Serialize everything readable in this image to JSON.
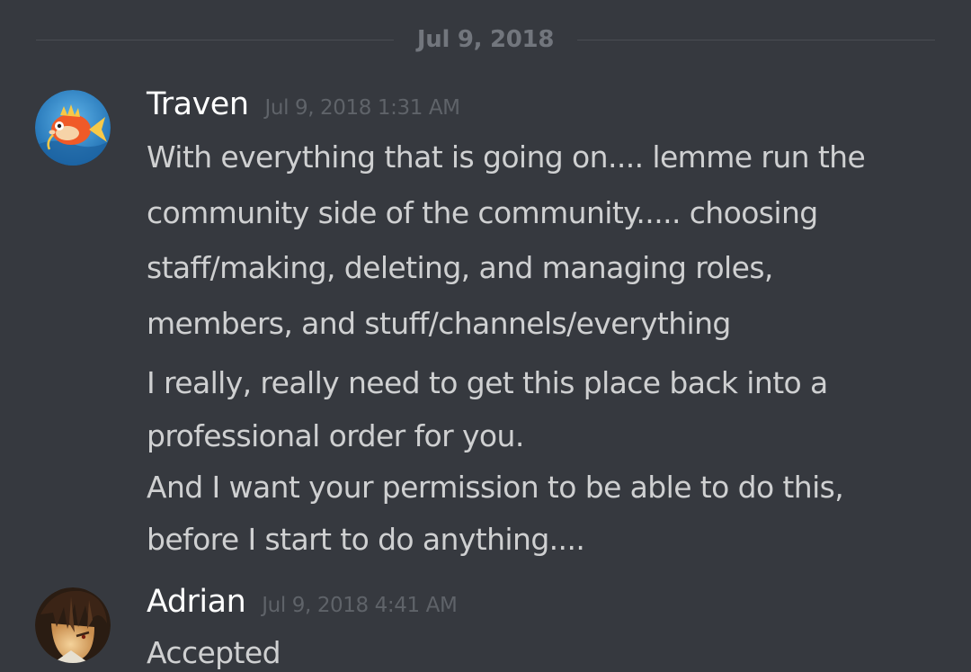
{
  "divider": {
    "date": "Jul 9, 2018"
  },
  "messages": [
    {
      "author": "Traven",
      "timestamp": "Jul 9, 2018 1:31 AM",
      "lines": [
        "With everything that is going on.... lemme run the",
        "community side of the community..... choosing",
        "staff/making, deleting, and managing roles,",
        "members, and stuff/channels/everything",
        "I really, really need to get this place back into a",
        "professional order for you.",
        "And I want your permission to be able to do this,",
        "before I start to do anything...."
      ]
    },
    {
      "author": "Adrian",
      "timestamp": "Jul 9, 2018 4:41 AM",
      "lines": [
        "Accepted"
      ]
    }
  ],
  "colors": {
    "background": "#36393f",
    "username": "#ffffff",
    "message_text": "#dcddde",
    "timestamp": "#72767d"
  }
}
